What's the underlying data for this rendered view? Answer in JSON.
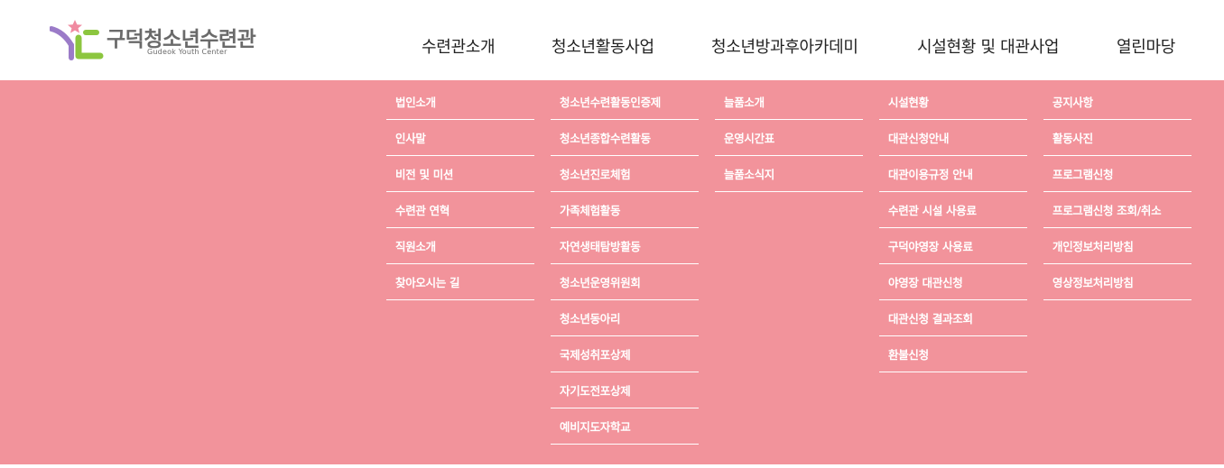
{
  "logo": {
    "title": "구덕청소년수련관",
    "subtitle": "Gudeok Youth Center",
    "colors": {
      "star": "#f08aa0",
      "purple": "#9b7bc8",
      "green": "#8cc63f"
    }
  },
  "nav": [
    {
      "label": "수련관소개"
    },
    {
      "label": "청소년활동사업"
    },
    {
      "label": "청소년방과후아카데미"
    },
    {
      "label": "시설현황 및 대관사업"
    },
    {
      "label": "열린마당"
    }
  ],
  "menus": [
    {
      "items": [
        "법인소개",
        "인사말",
        "비전 및 미션",
        "수련관 연혁",
        "직원소개",
        "찾아오시는 길"
      ]
    },
    {
      "items": [
        "청소년수련활동인증제",
        "청소년종합수련활동",
        "청소년진로체험",
        "가족체험활동",
        "자연생태탐방활동",
        "청소년운영위원회",
        "청소년동아리",
        "국제성취포상제",
        "자기도전포상제",
        "예비지도자학교"
      ]
    },
    {
      "items": [
        "늘품소개",
        "운영시간표",
        "늘품소식지"
      ]
    },
    {
      "items": [
        "시설현황",
        "대관신청안내",
        "대관이용규정 안내",
        "수련관 시설 사용료",
        "구덕야영장 사용료",
        "야영장 대관신청",
        "대관신청 결과조회",
        "환불신청"
      ]
    },
    {
      "items": [
        "공지사항",
        "활동사진",
        "프로그램신청",
        "프로그램신청 조회/취소",
        "개인정보처리방침",
        "영상정보처리방침"
      ]
    }
  ],
  "colors": {
    "dropdown_bg": "#f2939b",
    "nav_text": "#222222",
    "menu_text": "#ffffff"
  }
}
